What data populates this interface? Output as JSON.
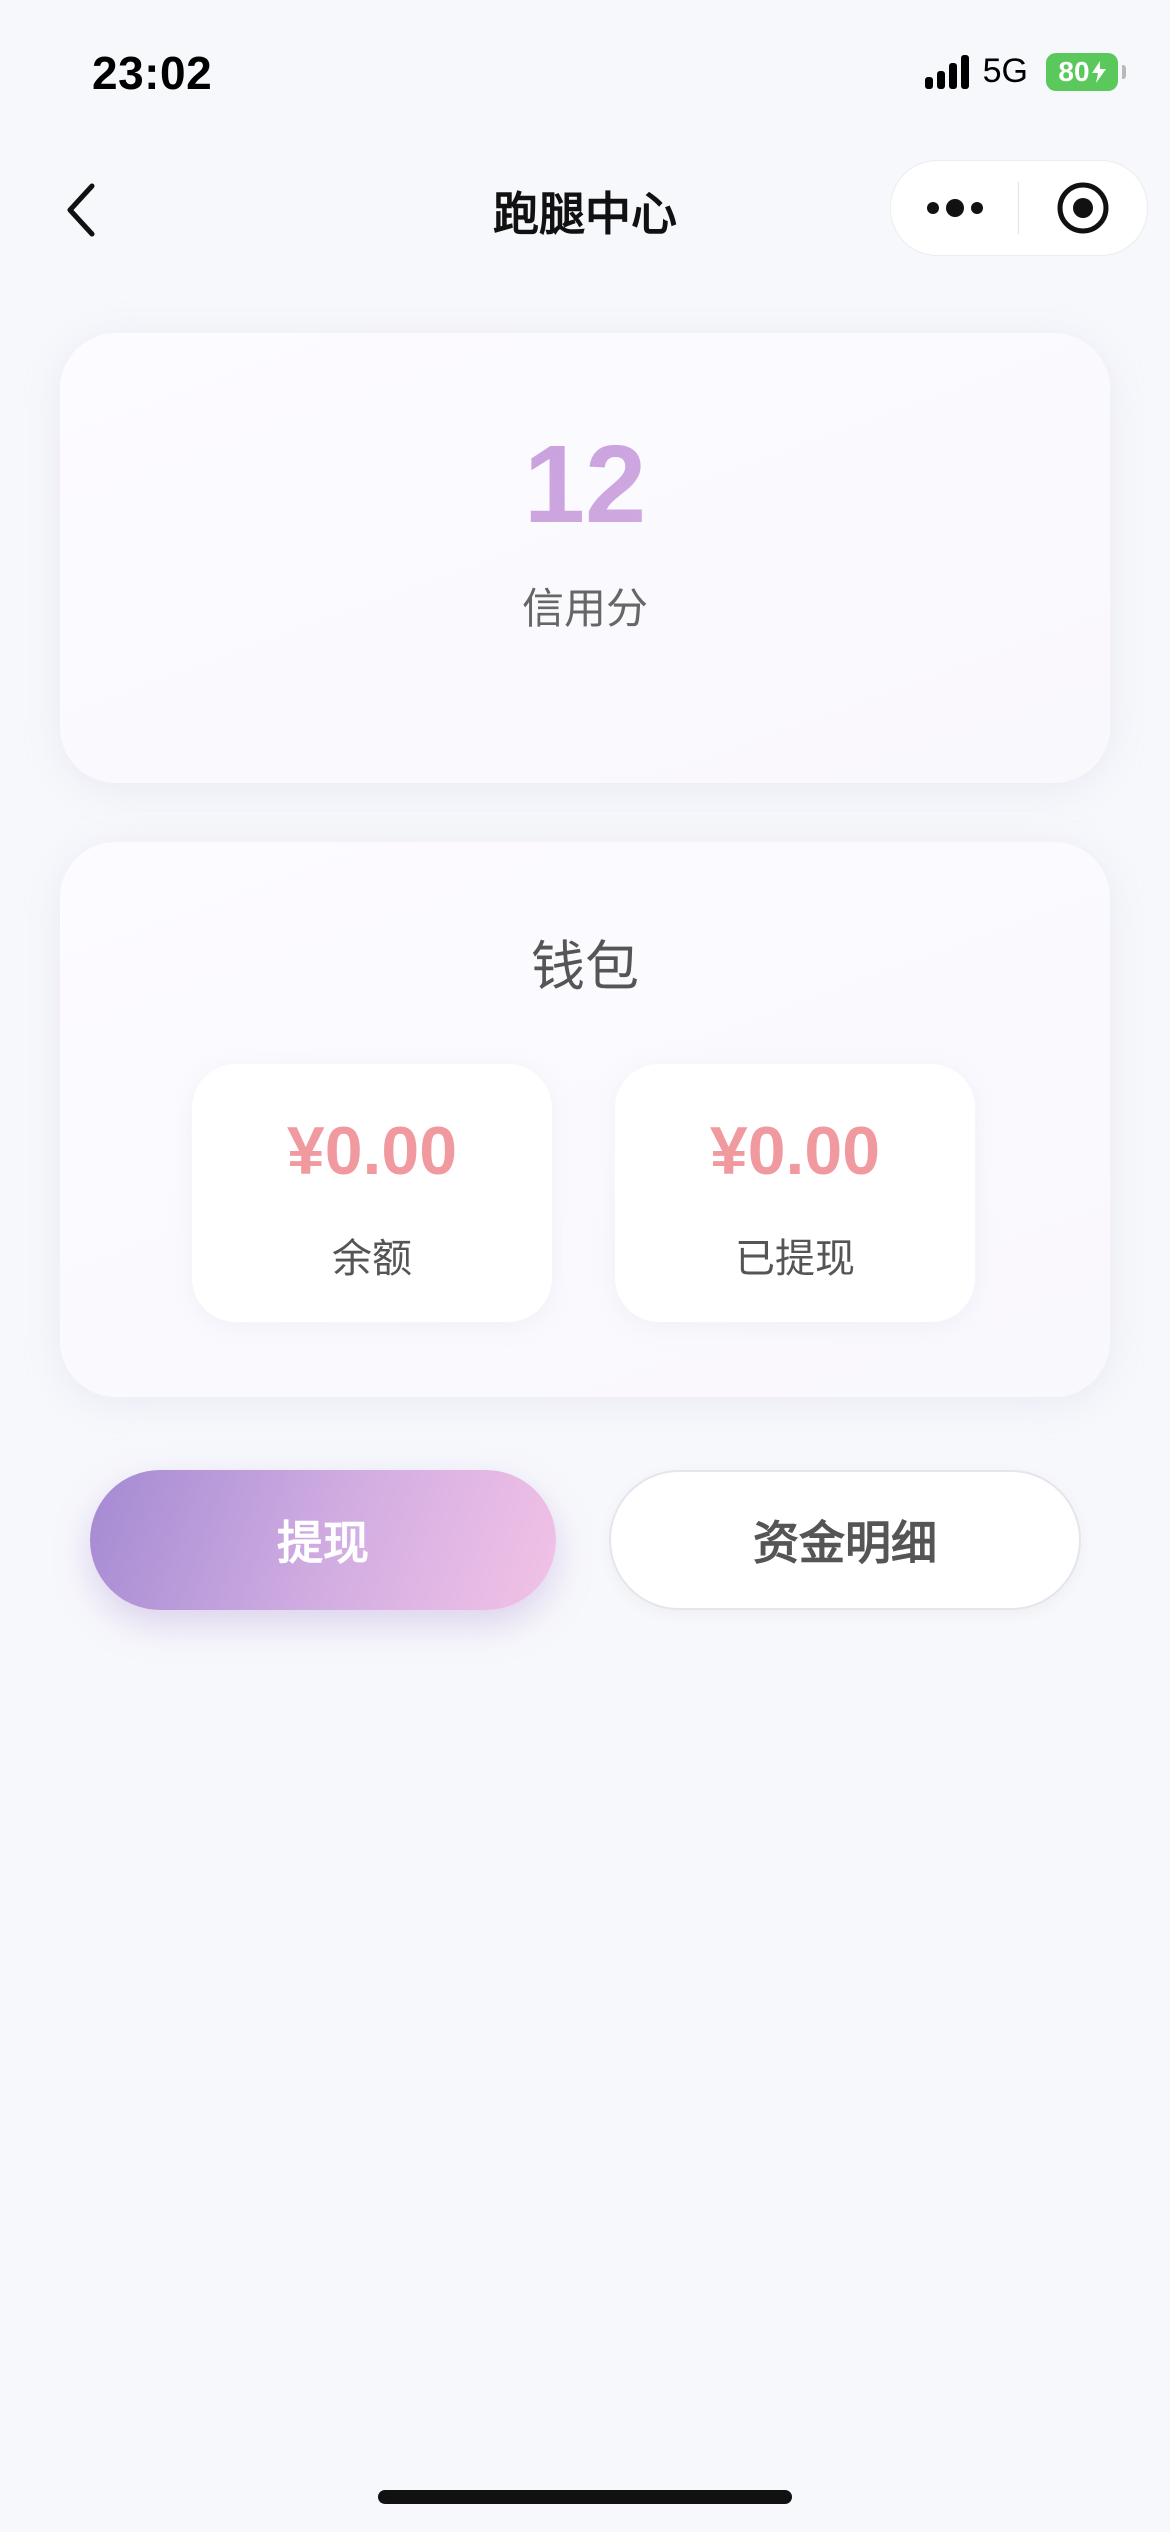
{
  "status_bar": {
    "time": "23:02",
    "network": "5G",
    "battery": "80"
  },
  "nav": {
    "title": "跑腿中心",
    "back_icon": "chevron-left-icon",
    "more_icon": "more-dots-icon",
    "close_icon": "target-close-icon"
  },
  "credit": {
    "value": "12",
    "label": "信用分"
  },
  "wallet": {
    "title": "钱包",
    "balance": {
      "amount": "¥0.00",
      "label": "余额"
    },
    "withdrawn": {
      "amount": "¥0.00",
      "label": "已提现"
    }
  },
  "actions": {
    "withdraw_label": "提现",
    "details_label": "资金明细"
  },
  "colors": {
    "accent_gradient_start": "#a48ad3",
    "accent_gradient_end": "#f3c2e6",
    "amount_color": "#f09a9f",
    "battery_green": "#5ac85a"
  }
}
